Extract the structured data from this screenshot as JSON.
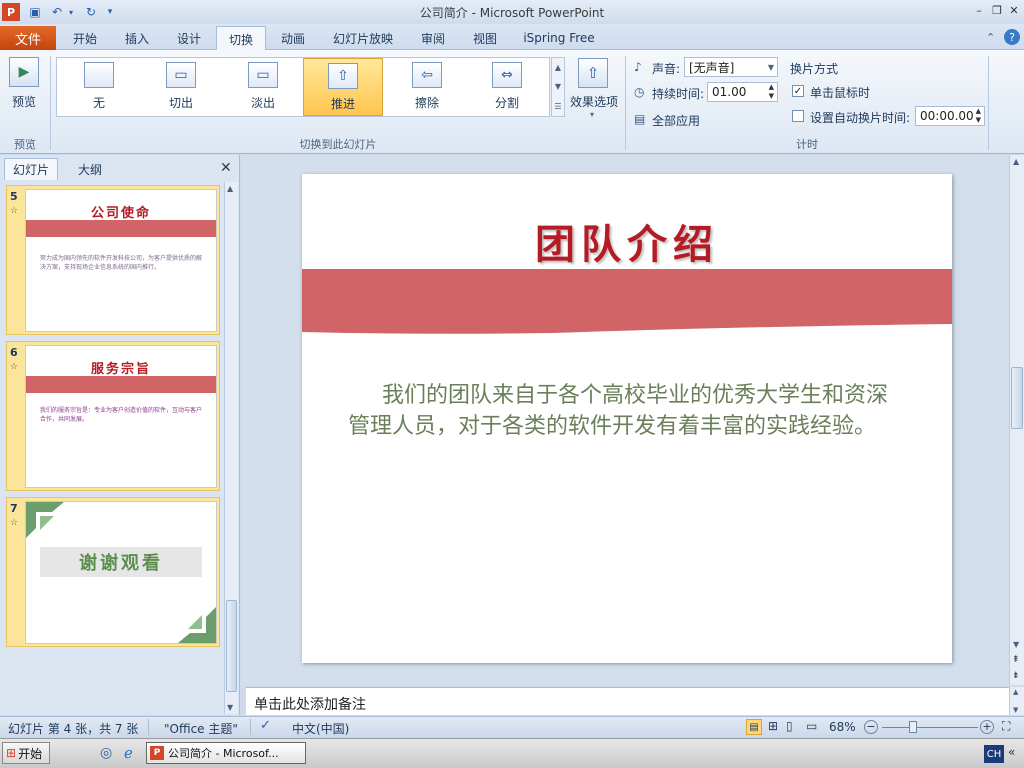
{
  "window": {
    "title": "公司简介 - Microsoft PowerPoint"
  },
  "tabs": [
    "文件",
    "开始",
    "插入",
    "设计",
    "切换",
    "动画",
    "幻灯片放映",
    "审阅",
    "视图",
    "iSpring Free"
  ],
  "ribbon": {
    "preview_label": "预览",
    "preview_group": "预览",
    "transitions": [
      "无",
      "切出",
      "淡出",
      "推进",
      "擦除",
      "分割"
    ],
    "selected_transition": "推进",
    "effect_options": "效果选项",
    "transition_group": "切换到此幻灯片",
    "sound_label": "声音:",
    "sound_value": "[无声音]",
    "duration_label": "持续时间:",
    "duration_value": "01.00",
    "apply_all": "全部应用",
    "advance_label": "换片方式",
    "on_click_label": "单击鼠标时",
    "on_click_checked": true,
    "auto_label": "设置自动换片时间:",
    "auto_checked": false,
    "auto_value": "00:00.00",
    "timing_group": "计时"
  },
  "panel": {
    "tab_slides": "幻灯片",
    "tab_outline": "大纲",
    "thumbs": [
      {
        "num": "5",
        "title": "公司使命",
        "text": "努力成为国内领先的软件开发科技公司，为客户提供优质的解决方案，支持现场企业信息系统的国内推行。"
      },
      {
        "num": "6",
        "title": "服务宗旨",
        "text": "我们的服务宗旨是：专业为客户创造价值的软件，互动与客户合作，共同发展。"
      },
      {
        "num": "7",
        "title": "谢谢观看",
        "text": ""
      }
    ]
  },
  "slide": {
    "title": "团队介绍",
    "body": "我们的团队来自于各个高校毕业的优秀大学生和资深管理人员，对于各类的软件开发有着丰富的实践经验。"
  },
  "notes": {
    "placeholder": "单击此处添加备注"
  },
  "status": {
    "slide_info": "幻灯片 第 4 张，共 7 张",
    "theme": "\"Office 主题\"",
    "language": "中文(中国)",
    "zoom": "68%",
    "zoom_level": 0.68
  },
  "taskbar": {
    "start": "开始",
    "task": "公司简介 - Microsof...",
    "ime": "CH"
  },
  "colors": {
    "accent": "#e36a2b",
    "slide_band": "#d16466",
    "slide_title": "#b51b24",
    "body_text": "#6a7f5a"
  }
}
